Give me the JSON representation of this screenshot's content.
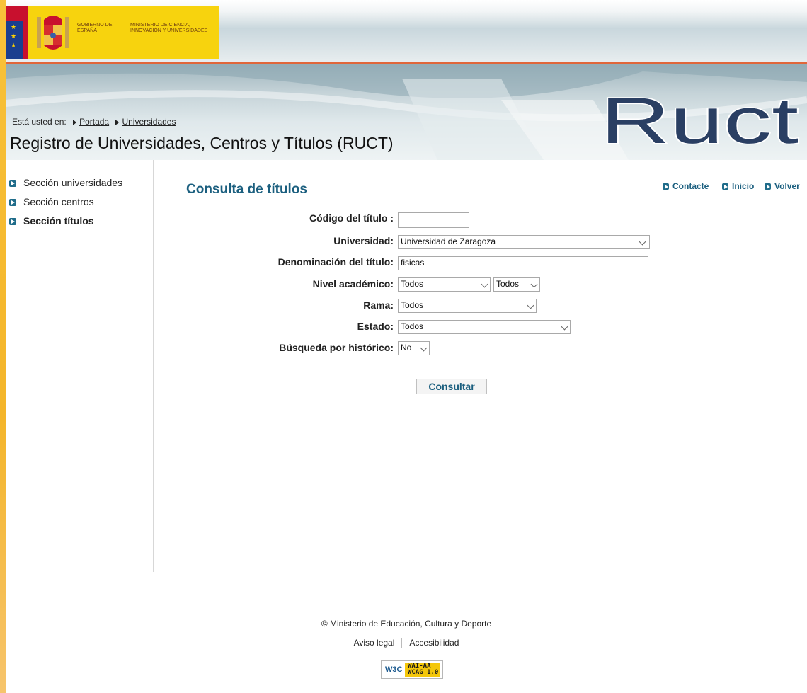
{
  "header": {
    "gov_name": "GOBIERNO DE ESPAÑA",
    "ministry_name": "MINISTERIO DE CIENCIA, INNOVACIÓN Y UNIVERSIDADES",
    "logo_text": "Ruct",
    "breadcrumb_prefix": "Está usted en:",
    "breadcrumb": [
      "Portada",
      "Universidades"
    ],
    "site_title": "Registro de Universidades, Centros y Títulos (RUCT)"
  },
  "sidebar": {
    "items": [
      {
        "label": "Sección universidades",
        "active": false
      },
      {
        "label": "Sección centros",
        "active": false
      },
      {
        "label": "Sección títulos",
        "active": true
      }
    ]
  },
  "main": {
    "heading": "Consulta de títulos",
    "top_links": [
      "Contacte",
      "Inicio",
      "Volver"
    ],
    "form": {
      "code_label": "Código del título :",
      "code_value": "",
      "university_label": "Universidad:",
      "university_value": "Universidad de Zaragoza",
      "name_label": "Denominación del título:",
      "name_value": "fisicas",
      "level_label": "Nivel académico:",
      "level_value_1": "Todos",
      "level_value_2": "Todos",
      "branch_label": "Rama:",
      "branch_value": "Todos",
      "state_label": "Estado:",
      "state_value": "Todos",
      "history_label": "Búsqueda por histórico:",
      "history_value": "No",
      "submit_label": "Consultar"
    }
  },
  "footer": {
    "copyright": "© Ministerio de Educación, Cultura y Deporte",
    "links": [
      "Aviso legal",
      "Accesibilidad"
    ],
    "badge_w3c": "W3C",
    "badge_line1": "WAI-AA",
    "badge_line2": "WCAG 1.0"
  },
  "colors": {
    "accent": "#1b5f7f",
    "gov_yellow": "#f7d30e",
    "header_line": "#e0663a",
    "bullet": "#1f6c8a"
  }
}
